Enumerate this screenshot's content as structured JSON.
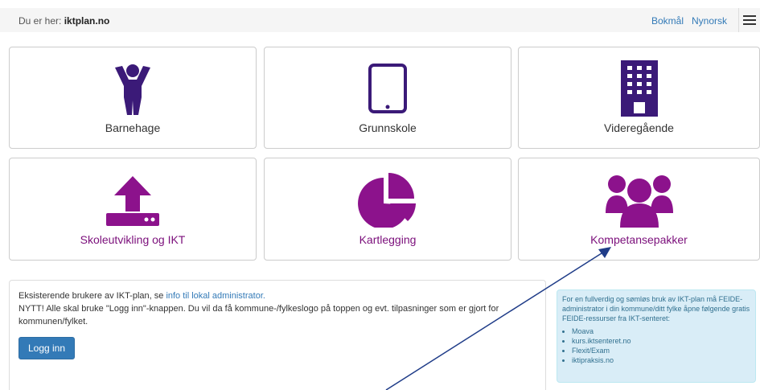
{
  "header": {
    "breadcrumb_prefix": "Du er her:",
    "breadcrumb_site": "iktplan.no",
    "lang_bokmal": "Bokmål",
    "lang_nynorsk": "Nynorsk"
  },
  "tiles": [
    {
      "label": "Barnehage",
      "icon": "child-icon"
    },
    {
      "label": "Grunnskole",
      "icon": "tablet-icon"
    },
    {
      "label": "Videregående",
      "icon": "building-icon"
    },
    {
      "label": "Skoleutvikling og IKT",
      "icon": "upload-icon"
    },
    {
      "label": "Kartlegging",
      "icon": "pie-chart-icon"
    },
    {
      "label": "Kompetansepakker",
      "icon": "users-icon"
    }
  ],
  "info": {
    "line1_text": "Eksisterende brukere av IKT-plan, se",
    "line1_link": "info til lokal administrator.",
    "line2": "NYTT! Alle skal bruke \"Logg inn\"-knappen. Du vil da få kommune-/fylkeslogo på toppen og evt. tilpasninger som er gjort for kommunen/fylket.",
    "login_label": "Logg inn"
  },
  "sidebar_info": {
    "intro": "For en fullverdig og sømløs bruk av IKT-plan må FEIDE-administrator i din kommune/ditt fylke åpne følgende gratis FEIDE-ressurser fra IKT-senteret:",
    "items": [
      "Moava",
      "kurs.iktsenteret.no",
      "Flexit/Exam",
      "iktipraksis.no"
    ]
  },
  "colors": {
    "primary_icon": "#3b1a78",
    "magenta_icon": "#8c128c",
    "link": "#337ab7",
    "annotation_arrow": "#1f3c88"
  }
}
